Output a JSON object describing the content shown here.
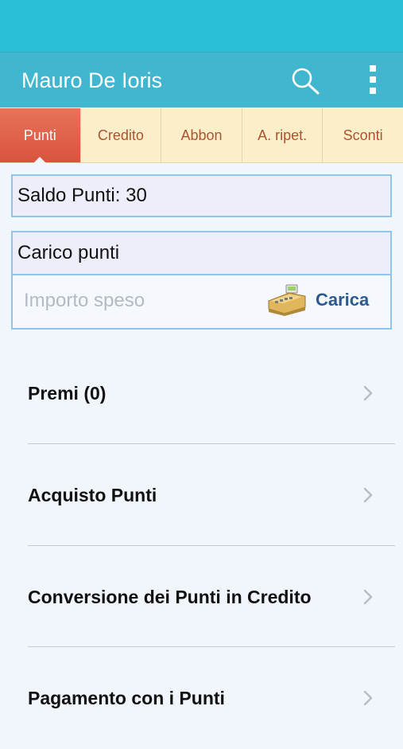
{
  "header": {
    "title": "Mauro De Ioris",
    "search_icon": "search-icon",
    "more_icon": "more-vertical-icon"
  },
  "tabs": [
    {
      "label": "Punti",
      "active": true
    },
    {
      "label": "Credito",
      "active": false
    },
    {
      "label": "Abbon",
      "active": false
    },
    {
      "label": "A. ripet.",
      "active": false
    },
    {
      "label": "Sconti",
      "active": false
    }
  ],
  "saldo": {
    "label": "Saldo Punti: 30"
  },
  "carico": {
    "title": "Carico punti",
    "placeholder": "Importo speso",
    "button_label": "Carica",
    "icon": "cash-register-icon"
  },
  "menu": [
    {
      "label": "Premi (0)"
    },
    {
      "label": "Acquisto Punti"
    },
    {
      "label": "Conversione dei Punti in Credito"
    },
    {
      "label": "Pagamento con i Punti"
    }
  ],
  "colors": {
    "status_bar": "#2bbcd6",
    "nav_bar": "#40b6cf",
    "tab_bg": "#faeecb",
    "tab_active": "#d9533d",
    "tab_text": "#b0522e",
    "accent_border": "#8fc6ea",
    "carica_text": "#2c5a8c"
  }
}
